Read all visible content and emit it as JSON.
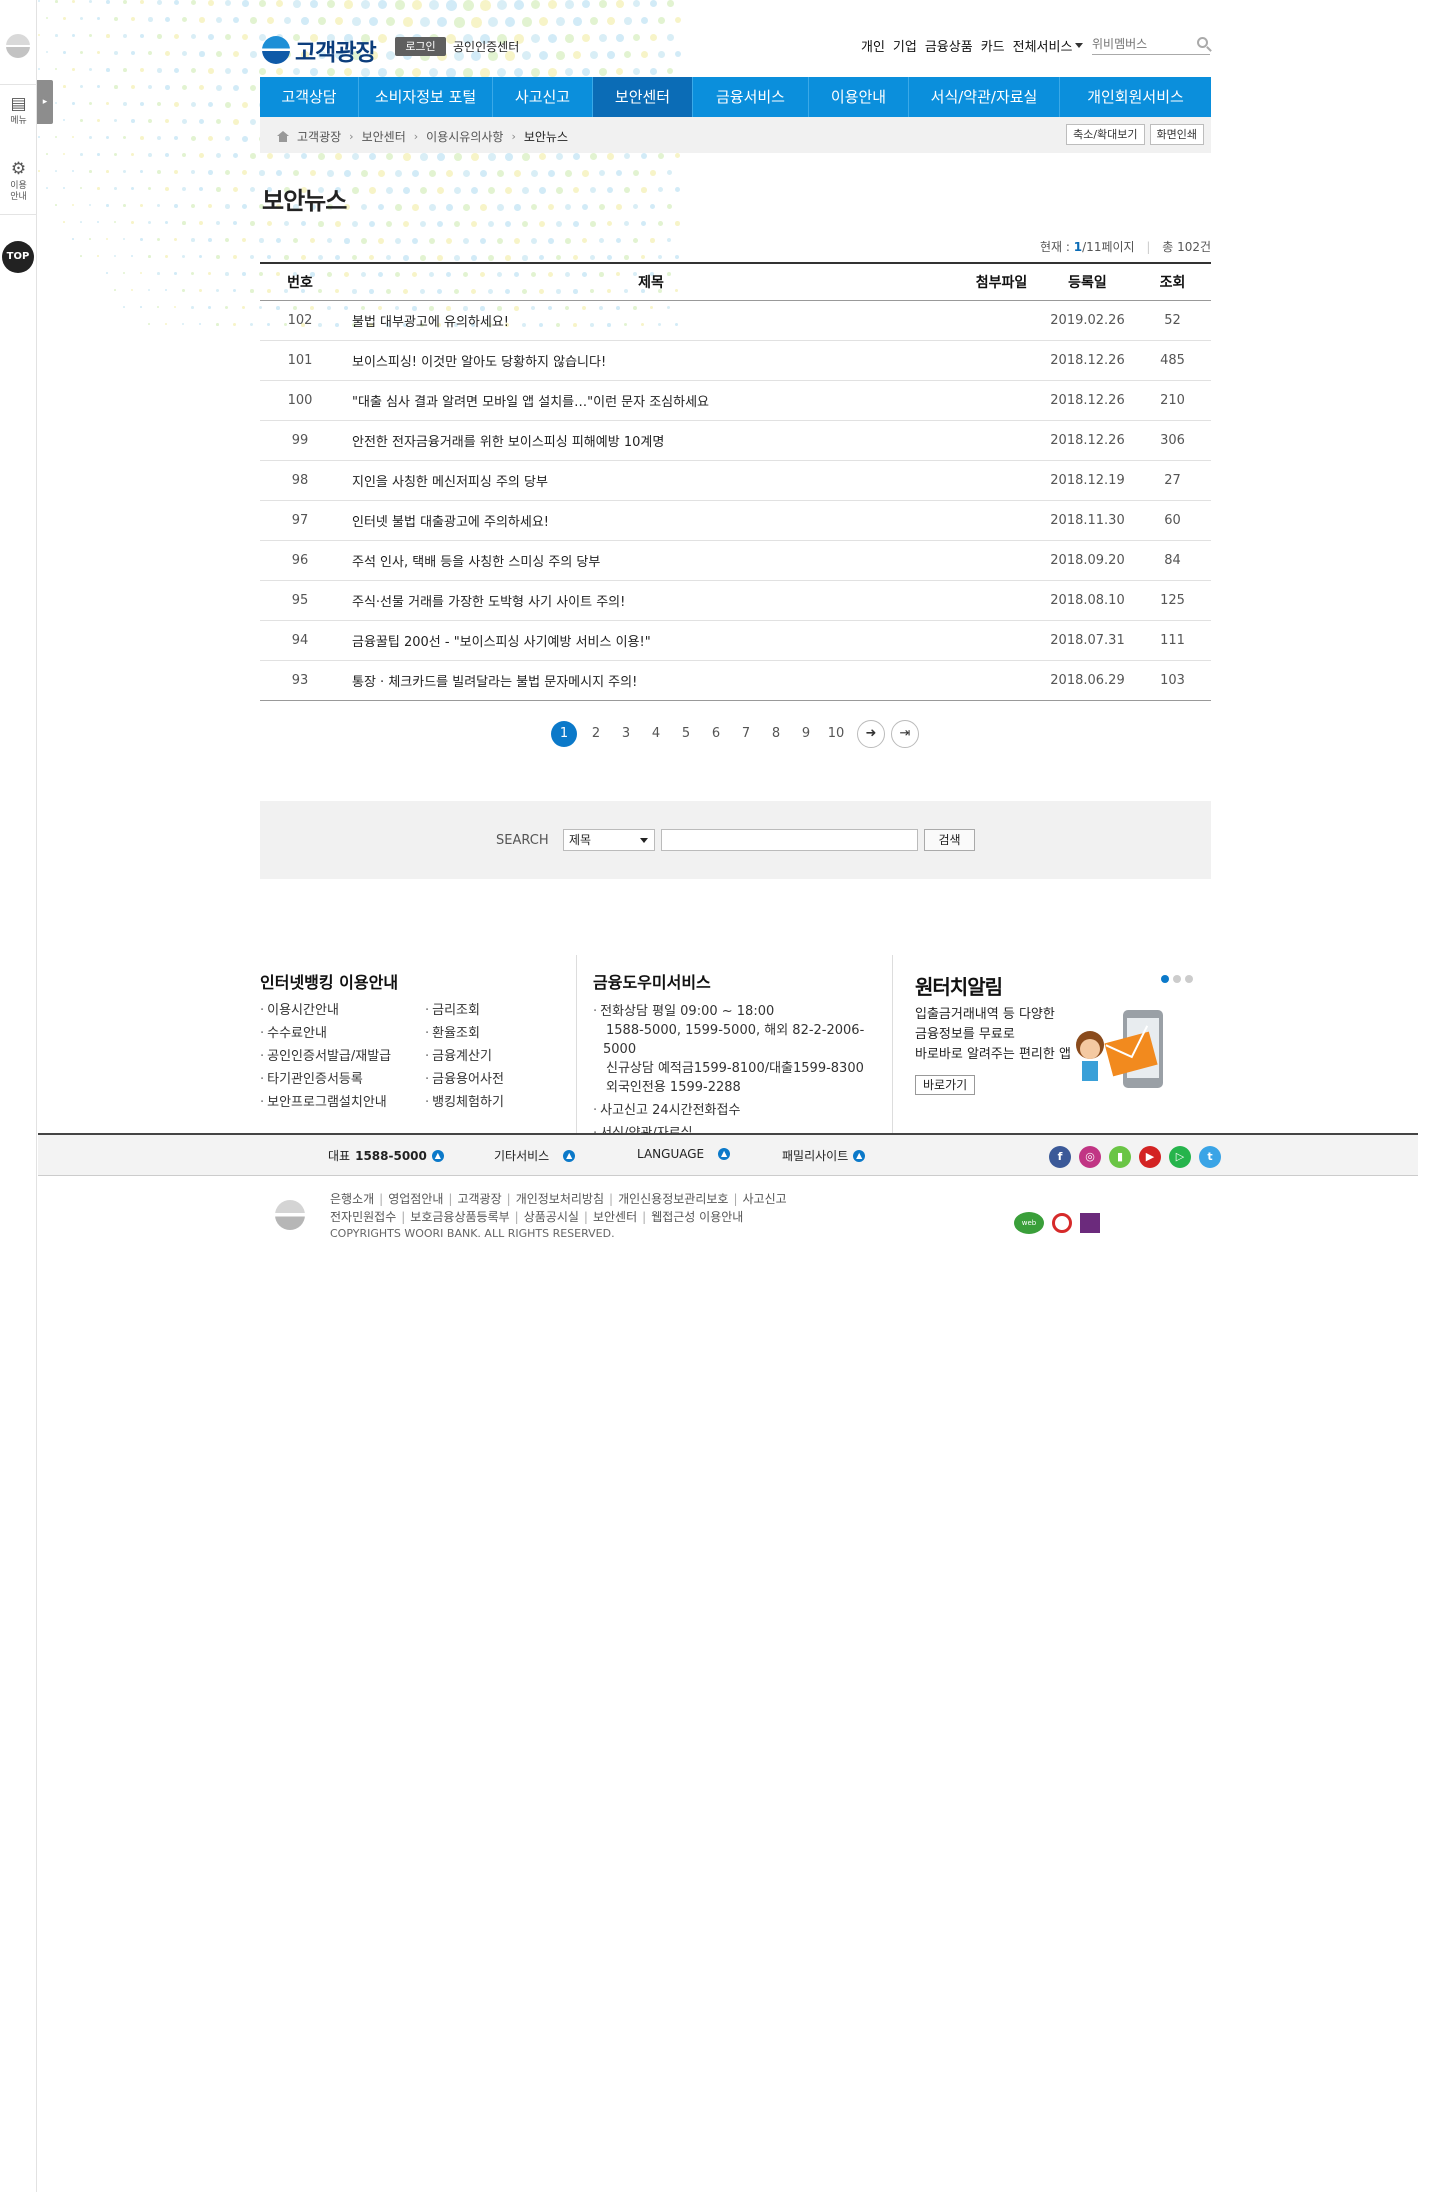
{
  "header": {
    "logo_text": "고객광장",
    "login_label": "로그인",
    "cert_center_label": "공인인증센터",
    "util_links": [
      "개인",
      "기업",
      "금융상품",
      "카드"
    ],
    "all_services_label": "전체서비스",
    "search_placeholder": "위비멤버스"
  },
  "gnb": {
    "items": [
      "고객상담",
      "소비자정보 포털",
      "사고신고",
      "보안센터",
      "금융서비스",
      "이용안내",
      "서식/약관/자료실",
      "개인회원서비스"
    ],
    "active_index": 3
  },
  "rail": {
    "menu_label": "메뉴",
    "guide_label": "이용\n안내",
    "top_label": "TOP"
  },
  "breadcrumb": {
    "items": [
      "고객광장",
      "보안센터",
      "이용시유의사항"
    ],
    "current": "보안뉴스",
    "zoom_button": "축소/확대보기",
    "print_button": "화면인쇄"
  },
  "page": {
    "title": "보안뉴스",
    "current_label": "현재 :",
    "current_page": "1",
    "total_pages_text": "/11페이지",
    "total_label": "총",
    "total_count": "102건"
  },
  "table": {
    "headers": [
      "번호",
      "제목",
      "첨부파일",
      "등록일",
      "조회"
    ],
    "rows": [
      {
        "num": "102",
        "title": "불법 대부광고에 유의하세요!",
        "date": "2019.02.26",
        "views": "52"
      },
      {
        "num": "101",
        "title": "보이스피싱! 이것만 알아도 당황하지 않습니다!",
        "date": "2018.12.26",
        "views": "485"
      },
      {
        "num": "100",
        "title": "\"대출 심사 결과 알려면 모바일 앱 설치를…\"이런 문자 조심하세요",
        "date": "2018.12.26",
        "views": "210"
      },
      {
        "num": "99",
        "title": "안전한 전자금융거래를 위한 보이스피싱 피해예방 10계명",
        "date": "2018.12.26",
        "views": "306"
      },
      {
        "num": "98",
        "title": "지인을 사칭한 메신저피싱 주의 당부",
        "date": "2018.12.19",
        "views": "27"
      },
      {
        "num": "97",
        "title": "인터넷 불법 대출광고에 주의하세요!",
        "date": "2018.11.30",
        "views": "60"
      },
      {
        "num": "96",
        "title": "주석 인사, 택배 등을 사칭한 스미싱 주의 당부",
        "date": "2018.09.20",
        "views": "84"
      },
      {
        "num": "95",
        "title": "주식·선물 거래를 가장한 도박형 사기 사이트 주의!",
        "date": "2018.08.10",
        "views": "125"
      },
      {
        "num": "94",
        "title": "금융꿀팁 200선 - \"보이스피싱 사기예방 서비스 이용!\"",
        "date": "2018.07.31",
        "views": "111"
      },
      {
        "num": "93",
        "title": "통장 · 체크카드를 빌려달라는 불법 문자메시지 주의!",
        "date": "2018.06.29",
        "views": "103"
      }
    ]
  },
  "pager": {
    "pages": [
      "1",
      "2",
      "3",
      "4",
      "5",
      "6",
      "7",
      "8",
      "9",
      "10"
    ],
    "active": "1"
  },
  "search": {
    "label": "SEARCH",
    "select_value": "제목",
    "button": "검색"
  },
  "footer": {
    "col1": {
      "title": "인터넷뱅킹 이용안내",
      "left": [
        "이용시간안내",
        "수수료안내",
        "공인인증서발급/재발급",
        "타기관인증서등록",
        "보안프로그램설치안내"
      ],
      "right": [
        "금리조회",
        "환율조회",
        "금융계산기",
        "금융용어사전",
        "뱅킹체험하기"
      ]
    },
    "col2": {
      "title": "금융도우미서비스",
      "phone_title": "전화상담 평일 09:00 ~ 18:00",
      "phone_lines": [
        "1588-5000, 1599-5000, 해외 82-2-2006-5000",
        "신규상담 예적금1599-8100/대출1599-8300",
        "외국인전용 1599-2288"
      ],
      "links": [
        "사고신고 24시간전화접수",
        "서식/약관/자료실"
      ]
    },
    "col3": {
      "title": "원터치알림",
      "desc": [
        "입출금거래내역 등 다양한",
        "금융정보를 무료로",
        "바로바로 알려주는 편리한 앱"
      ],
      "button": "바로가기"
    },
    "bar": {
      "rep": "대표",
      "rep_num": "1588-5000",
      "other": "기타서비스",
      "language": "LANGUAGE",
      "family": "패밀리사이트"
    },
    "sns": [
      {
        "name": "facebook-icon",
        "glyph": "f",
        "color": "#3b5998"
      },
      {
        "name": "instagram-icon",
        "glyph": "◎",
        "color": "#c13584"
      },
      {
        "name": "kakaostory-icon",
        "glyph": "▮",
        "color": "#6ac545"
      },
      {
        "name": "youtube-icon",
        "glyph": "▶",
        "color": "#d32323"
      },
      {
        "name": "play-icon",
        "glyph": "▷",
        "color": "#26b44c"
      },
      {
        "name": "twitter-icon",
        "glyph": "t",
        "color": "#3aa4e6"
      }
    ],
    "bottom_links_1": [
      "은행소개",
      "영업점안내",
      "고객광장",
      "개인정보처리방침",
      "개인신용정보관리보호",
      "사고신고"
    ],
    "bottom_links_2": [
      "전자민원접수",
      "보호금융상품등록부",
      "상품공시실",
      "보안센터",
      "웹접근성 이용안내"
    ],
    "copyright": "COPYRIGHTS WOORI BANK. ALL RIGHTS RESERVED.",
    "mark_label": "web"
  },
  "colors": {
    "brand": "#0b8fdc",
    "brand_dark": "#0b6cb6",
    "accent": "#0b79c9"
  }
}
